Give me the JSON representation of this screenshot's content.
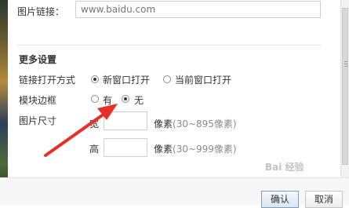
{
  "image_link": {
    "label": "图片链接：",
    "placeholder": "www.baidu.com"
  },
  "more_settings": {
    "title": "更多设置",
    "link_open": {
      "label": "链接打开方式",
      "options": [
        {
          "label": "新窗口打开",
          "checked": true
        },
        {
          "label": "当前窗口打开",
          "checked": false
        }
      ]
    },
    "border": {
      "label": "模块边框",
      "options": [
        {
          "label": "有",
          "checked": false
        },
        {
          "label": "无",
          "checked": true
        }
      ]
    },
    "image_size": {
      "label": "图片尺寸",
      "width_label": "宽",
      "height_label": "高",
      "unit": "像素",
      "width_hint": "(30~895像素)",
      "height_hint": "(30~999像素)"
    }
  },
  "footer": {
    "confirm_label": "确认",
    "cancel_label": "取消"
  },
  "watermark": "Bai 经验",
  "colors": {
    "arrow": "#e8302b",
    "divider": "#e3e3e3",
    "hint": "#8a8a8a"
  }
}
